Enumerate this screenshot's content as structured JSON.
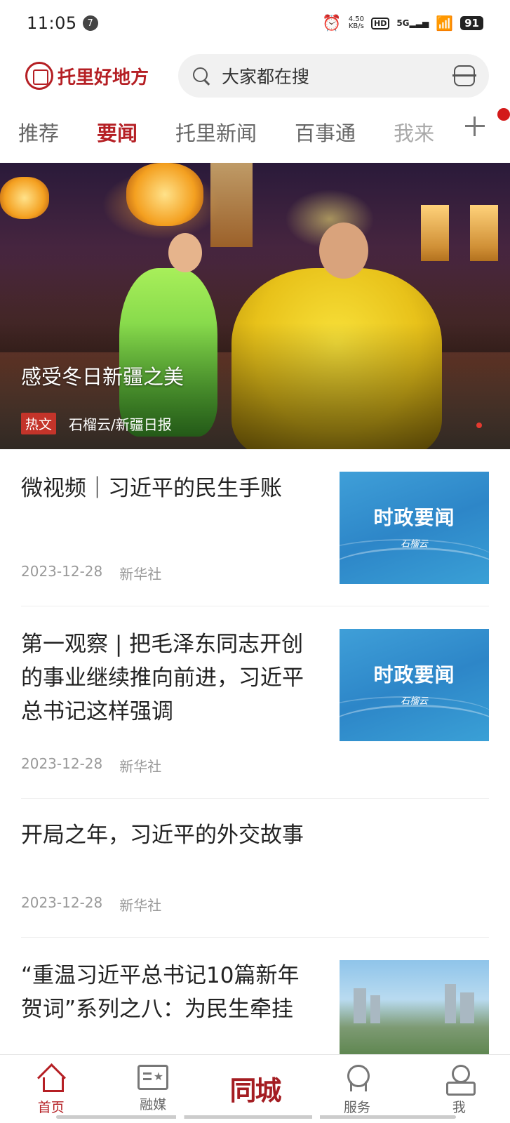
{
  "status_bar": {
    "time": "11:05",
    "notification_count": "7",
    "net_speed_value": "4.50",
    "net_speed_unit": "KB/s",
    "hd_label": "HD",
    "network_label": "5G",
    "battery": "91"
  },
  "header": {
    "app_name": "托里好地方",
    "search_placeholder": "大家都在搜"
  },
  "tabs": [
    {
      "label": "推荐"
    },
    {
      "label": "要闻"
    },
    {
      "label": "托里新闻"
    },
    {
      "label": "百事通"
    },
    {
      "label": "我来"
    }
  ],
  "hero": {
    "title": "感受冬日新疆之美",
    "tag": "热文",
    "source": "石榴云/新疆日报"
  },
  "news": [
    {
      "title": "微视频｜习近平的民生手账",
      "date": "2023-12-28",
      "source": "新华社",
      "thumb_title": "时政要闻",
      "thumb_sub": "石榴云"
    },
    {
      "title": "第一观察 | 把毛泽东同志开创的事业继续推向前进，习近平总书记这样强调",
      "date": "2023-12-28",
      "source": "新华社",
      "thumb_title": "时政要闻",
      "thumb_sub": "石榴云"
    },
    {
      "title": "开局之年，习近平的外交故事",
      "date": "2023-12-28",
      "source": "新华社"
    },
    {
      "title": "“重温习近平总书记10篇新年贺词”系列之八：为民生牵挂"
    }
  ],
  "bottom_nav": [
    {
      "label": "首页"
    },
    {
      "label": "融媒"
    },
    {
      "label": "同城"
    },
    {
      "label": "服务"
    },
    {
      "label": "我"
    }
  ],
  "colors": {
    "brand_red": "#b51f24",
    "tag_red": "#c4342a",
    "meta_gray": "#999999"
  },
  "icons": [
    "search-icon",
    "scan-icon",
    "add-icon",
    "home-icon",
    "media-icon",
    "service-icon",
    "me-icon"
  ]
}
